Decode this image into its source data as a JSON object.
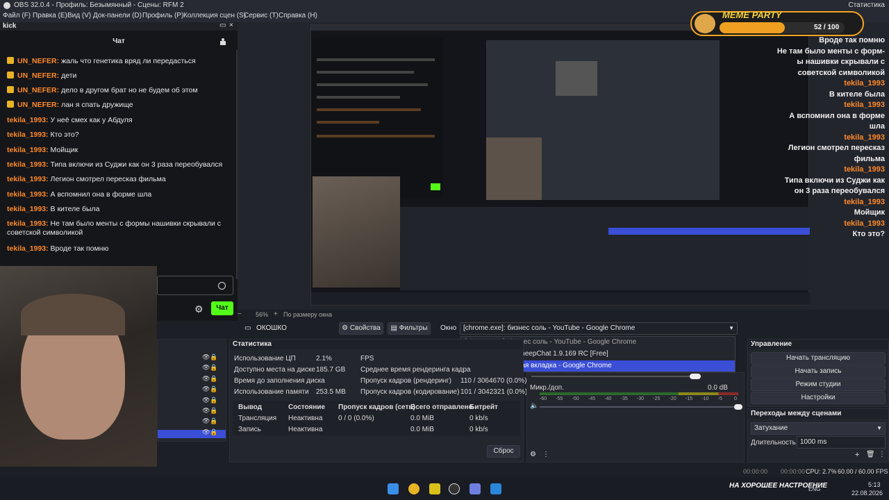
{
  "titlebar": {
    "title": "OBS 32.0.4 - Профиль: Безымянный - Сцены: RFM 2",
    "right_text": "Статистика"
  },
  "menu": [
    "Файл (F)",
    "Правка (E)",
    "Вид (V)",
    "Док-панели (D)",
    "Профиль (P)",
    "Коллекция сцен (S)",
    "Сервис (T)",
    "Справка (H)"
  ],
  "chat": {
    "window_title": "kick",
    "title": "Чат",
    "messages": [
      {
        "user": "UN_NEFER:",
        "text": "жаль что генетика вряд ли передасться",
        "badge": true
      },
      {
        "user": "UN_NEFER:",
        "text": "дети",
        "badge": true
      },
      {
        "user": "UN_NEFER:",
        "text": "дело в другом брат но не будем об этом",
        "badge": true
      },
      {
        "user": "UN_NEFER:",
        "text": "лан я спать дружище",
        "badge": true
      },
      {
        "user": "tekila_1993:",
        "text": "У неё смех как у Абдуля",
        "badge": false
      },
      {
        "user": "tekila_1993:",
        "text": "Кто это?",
        "badge": false
      },
      {
        "user": "tekila_1993:",
        "text": "Мойщик",
        "badge": false
      },
      {
        "user": "tekila_1993:",
        "text": "Типа включи из Суджи как он 3 раза переобувался",
        "badge": false
      },
      {
        "user": "tekila_1993:",
        "text": "Легион смотрел пересказ фильма",
        "badge": false
      },
      {
        "user": "tekila_1993:",
        "text": "А вспомнил она в форме шла",
        "badge": false
      },
      {
        "user": "tekila_1993:",
        "text": "В кителе была",
        "badge": false
      },
      {
        "user": "tekila_1993:",
        "text": "Не там было менты с формы нашивки скрывали с советской символикой",
        "badge": false
      },
      {
        "user": "tekila_1993:",
        "text": "Вроде так помню",
        "badge": false
      }
    ],
    "send_label": "Чат"
  },
  "preview": {
    "zoom": "56%",
    "fit": "По размеру окна"
  },
  "source": {
    "name": "ОКОШКО",
    "props_label": "Свойства",
    "filters_label": "Фильтры",
    "window_label": "Окно",
    "window_value": "[chrome.exe]: бизнес соль - YouTube - Google Chrome"
  },
  "dropdown": {
    "items": [
      "[chrome.exe]: бизнес соль - YouTube - Google Chrome",
      "[sheepchat.exe]: sheepChat 1.9.169 RC [Free]",
      "[chrome.exe]: Новая вкладка - Google Chrome"
    ],
    "selected": 2
  },
  "stats": {
    "title": "Статистика",
    "cpu_label": "Использование ЦП",
    "cpu": "2.1%",
    "fps_label": "FPS",
    "disk_label": "Доступно места на диске",
    "disk": "185.7 GB",
    "render_label": "Среднее время рендеринга кадра",
    "fill_label": "Время до заполнения диска",
    "skip_render_label": "Пропуск кадров (рендеринг)",
    "skip_render": "110 / 3064670 (0.0%)",
    "mem_label": "Использование памяти",
    "mem": "253.5 MB",
    "skip_enc_label": "Пропуск кадров (кодирование)",
    "skip_enc": "101 / 3042321 (0.0%)",
    "cols": [
      "Вывод",
      "Состояние",
      "Пропуск кадров (сеть)",
      "Всего отправлено",
      "Битрейт"
    ],
    "rows": [
      [
        "Трансляция",
        "Неактивна",
        "0 / 0 (0.0%)",
        "0.0 MiB",
        "0 kb/s"
      ],
      [
        "Запись",
        "Неактивна",
        "",
        "0.0 MiB",
        "0 kb/s"
      ]
    ],
    "reset_label": "Сброс"
  },
  "mixer": {
    "mic_label": "Микр./доп.",
    "mic_db": "0.0 dB",
    "ticks": [
      "-60",
      "-55",
      "-50",
      "-45",
      "-40",
      "-35",
      "-30",
      "-25",
      "-20",
      "-15",
      "-10",
      "-5",
      "0"
    ]
  },
  "controls": {
    "title": "Управление",
    "buttons": [
      "Начать трансляцию",
      "Начать запись",
      "Режим студии",
      "Настройки"
    ]
  },
  "transitions": {
    "title": "Переходы между сценами",
    "type": "Затухание",
    "duration_label": "Длительность",
    "duration": "1000 ms"
  },
  "statusbar": {
    "t1": "00:00:00",
    "t2": "00:00:00",
    "cpu": "CPU: 2.7%",
    "fps": "60.00 / 60.00 FPS"
  },
  "taskbar": {
    "time": "5:13",
    "date": "22.08.2026",
    "lang": "ENG",
    "tagline": "НА ХОРОШЕЕ НАСТРОЕНИЕ"
  },
  "overlay": {
    "meme_title": "MEME PARTY",
    "meme_count": "52 / 100",
    "lines": [
      {
        "user": "",
        "text": "Вроде так помню"
      },
      {
        "user": "",
        "text": "Не там было менты с форм-"
      },
      {
        "user": "",
        "text": "ы нашивки скрывали с"
      },
      {
        "user": "",
        "text": "советской символикой"
      },
      {
        "user": "tekila_1993",
        "text": ""
      },
      {
        "user": "",
        "text": "В кителе была"
      },
      {
        "user": "tekila_1993",
        "text": ""
      },
      {
        "user": "",
        "text": "А вспомнил она в форме"
      },
      {
        "user": "",
        "text": "шла"
      },
      {
        "user": "tekila_1993",
        "text": ""
      },
      {
        "user": "",
        "text": "Легион смотрел пересказ"
      },
      {
        "user": "",
        "text": "фильма"
      },
      {
        "user": "tekila_1993",
        "text": ""
      },
      {
        "user": "",
        "text": "Типа включи из Суджи как"
      },
      {
        "user": "",
        "text": "он 3 раза переобувался"
      },
      {
        "user": "tekila_1993",
        "text": ""
      },
      {
        "user": "",
        "text": "Мойщик"
      },
      {
        "user": "tekila_1993",
        "text": ""
      },
      {
        "user": "",
        "text": "Кто это?"
      }
    ]
  }
}
